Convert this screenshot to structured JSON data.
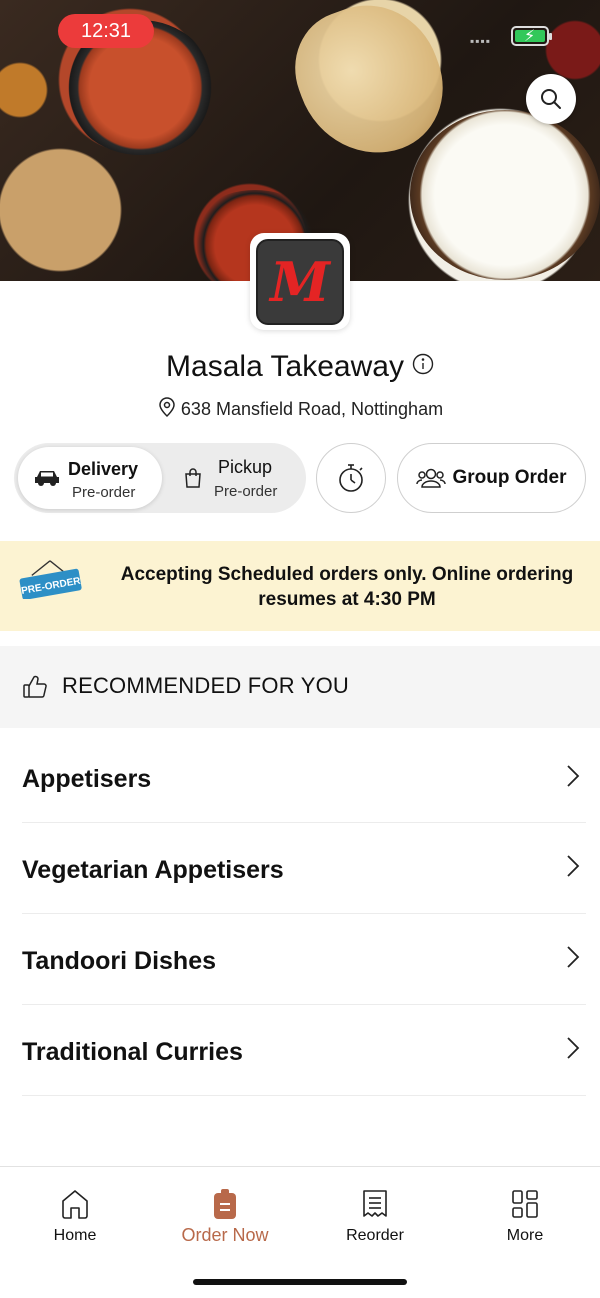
{
  "status_bar": {
    "time": "12:31"
  },
  "restaurant": {
    "name": "Masala Takeaway",
    "logo_letter": "M",
    "address": "638 Mansfield Road, Nottingham"
  },
  "order_mode": {
    "delivery": {
      "label": "Delivery",
      "sub": "Pre-order",
      "selected": true
    },
    "pickup": {
      "label": "Pickup",
      "sub": "Pre-order",
      "selected": false
    }
  },
  "group_order_label": "Group Order",
  "banner": {
    "tag": "PRE-ORDER",
    "message": "Accepting Scheduled orders only. Online ordering resumes at 4:30 PM"
  },
  "recommended_label": "RECOMMENDED FOR YOU",
  "categories": [
    {
      "label": "Appetisers"
    },
    {
      "label": "Vegetarian Appetisers"
    },
    {
      "label": "Tandoori Dishes"
    },
    {
      "label": "Traditional Curries"
    }
  ],
  "tabs": [
    {
      "label": "Home",
      "icon": "home-icon",
      "active": false
    },
    {
      "label": "Order Now",
      "icon": "order-now-icon",
      "active": true
    },
    {
      "label": "Reorder",
      "icon": "receipt-icon",
      "active": false
    },
    {
      "label": "More",
      "icon": "grid-icon",
      "active": false
    }
  ],
  "colors": {
    "accent": "#b8694a",
    "banner_bg": "#fcf3d2",
    "status_time_bg": "#ec3b3b",
    "battery": "#32c85a",
    "logo_red": "#e42424",
    "preorder_tag": "#2d8fc6"
  }
}
